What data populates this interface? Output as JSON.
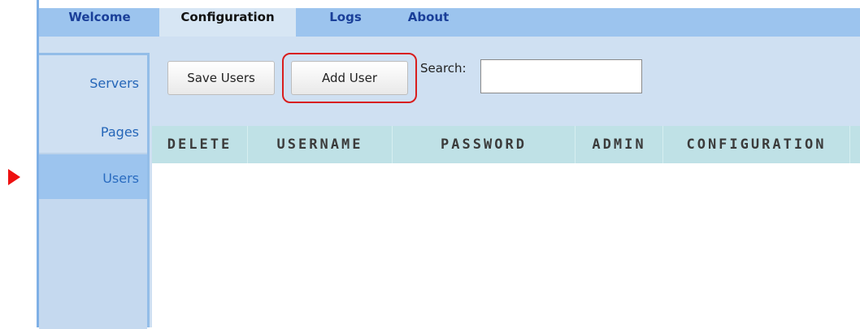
{
  "tabs": [
    {
      "label": "Welcome"
    },
    {
      "label": "Configuration"
    },
    {
      "label": "Logs"
    },
    {
      "label": "About"
    }
  ],
  "active_tab": "Configuration",
  "sidebar": {
    "items": [
      {
        "label": "Servers"
      },
      {
        "label": "Pages"
      },
      {
        "label": "Users"
      }
    ],
    "active": "Users"
  },
  "toolbar": {
    "save_users_label": "Save Users",
    "add_user_label": "Add User",
    "search_label": "Search:",
    "search_value": ""
  },
  "table": {
    "columns": [
      "DELETE",
      "USERNAME",
      "PASSWORD",
      "ADMIN",
      "CONFIGURATION"
    ],
    "rows": []
  },
  "colors": {
    "tab_bar": "#9cc4ee",
    "content_bg": "#cfe0f2",
    "header_bg": "#bfe1e6",
    "highlight": "#d81e1e",
    "pointer_arrow": "#ee1111"
  }
}
